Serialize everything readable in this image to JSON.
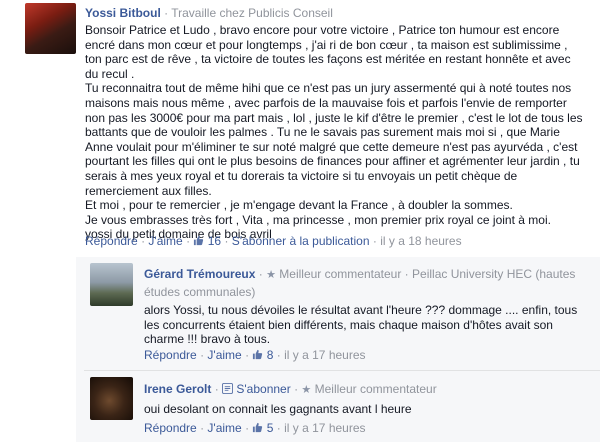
{
  "comments": [
    {
      "author": "Yossi Bitboul",
      "subtitle": "Travaille chez Publicis Conseil",
      "paragraphs": [
        "Bonsoir Patrice et Ludo , bravo encore pour votre victoire , Patrice ton humour est encore encré dans mon cœur et pour longtemps , j'ai ri de bon cœur , ta maison est sublimissime , ton parc est de rêve , ta victoire de toutes les façons est méritée en restant honnête et avec du recul .",
        "Tu reconnaitra tout de même hihi que ce n'est pas un jury assermenté qui à noté toutes nos maisons mais nous même , avec parfois de la mauvaise fois et parfois l'envie de remporter non pas les 3000€ pour ma part mais , lol , juste le kif d'être le premier , c'est le lot de tous les battants que de vouloir les palmes . Tu ne le savais pas surement mais moi si , que Marie Anne voulait pour m'éliminer te sur noté malgré que cette demeure n'est pas ayurvéda , c'est pourtant les filles qui ont le plus besoins de finances pour affiner et agrémenter leur jardin , tu serais à mes yeux royal et tu dorerais ta victoire si tu envoyais un petit chèque de remerciement aux filles.",
        "Et moi , pour te remercier , je m'engage devant la France , à doubler la sommes.",
        "Je vous embrasses très fort , Vita , ma princesse , mon premier prix royal ce joint à moi.",
        "yossi du petit domaine de bois avril"
      ],
      "actions": {
        "reply": "Répondre",
        "like": "J'aime",
        "like_count": "16",
        "subscribe": "S'abonner à la publication",
        "time": "il y a 18 heures"
      }
    },
    {
      "author": "Gérard Trémoureux",
      "badge": "Meilleur commentateur",
      "subtitle": "Peillac University HEC (hautes études communales)",
      "text": "alors Yossi, tu nous dévoiles le résultat avant l'heure ??? dommage .... enfin, tous les concurrents étaient bien différents, mais chaque maison d'hôtes avait son charme !!! bravo à tous.",
      "actions": {
        "reply": "Répondre",
        "like": "J'aime",
        "like_count": "8",
        "time": "il y a 17 heures"
      }
    },
    {
      "author": "Irene Gerolt",
      "subscribe": "S'abonner",
      "badge": "Meilleur commentateur",
      "text": "oui desolant on connait les gagnants avant l heure",
      "actions": {
        "reply": "Répondre",
        "like": "J'aime",
        "like_count": "5",
        "time": "il y a 17 heures"
      }
    }
  ]
}
